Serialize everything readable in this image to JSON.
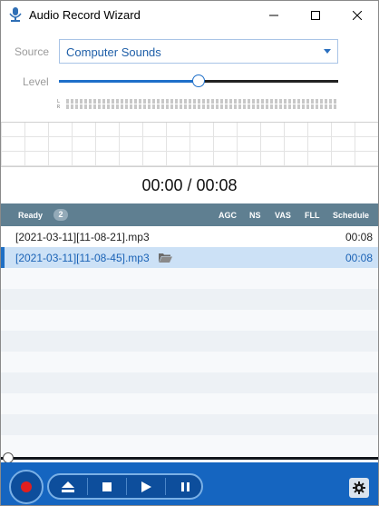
{
  "window": {
    "title": "Audio Record Wizard"
  },
  "source": {
    "label": "Source",
    "value": "Computer Sounds"
  },
  "level": {
    "label": "Level",
    "value": 0.5,
    "meter_left_label": "L",
    "meter_right_label": "R"
  },
  "timer": {
    "text": "00:00 / 00:08"
  },
  "list": {
    "status": "Ready",
    "count": "2",
    "columns": {
      "agc": "AGC",
      "ns": "NS",
      "vas": "VAS",
      "fll": "FLL",
      "schedule": "Schedule"
    },
    "rows": [
      {
        "name": "[2021-03-11][11-08-21].mp3",
        "duration": "00:08"
      },
      {
        "name": "[2021-03-11][11-08-45].mp3",
        "duration": "00:08"
      }
    ]
  },
  "icons": {
    "app": "microphone-icon",
    "minimize": "minimize-icon",
    "maximize": "maximize-icon",
    "close": "close-icon",
    "folder": "folder-icon",
    "record": "record-icon",
    "eject": "eject-icon",
    "stop": "stop-icon",
    "play": "play-icon",
    "pause": "pause-icon",
    "settings": "gear-icon"
  },
  "colors": {
    "accent": "#1565c0",
    "record": "#e01f1f",
    "header": "#5f7f91",
    "selection": "#cce1f6"
  }
}
